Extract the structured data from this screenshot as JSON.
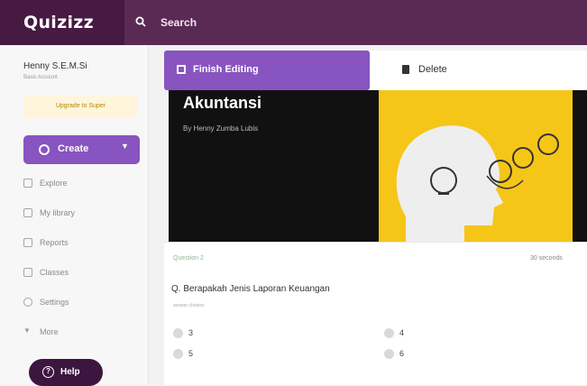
{
  "header": {
    "logo": "Quizizz",
    "search_label": "Search"
  },
  "sidebar": {
    "user_name": "Henny S.E.M.Si",
    "user_subtitle": "Basic Account",
    "upgrade_label": "Upgrade to Super",
    "create_label": "Create",
    "nav": [
      {
        "label": "Explore",
        "icon": "compass-icon"
      },
      {
        "label": "My library",
        "icon": "library-icon"
      },
      {
        "label": "Reports",
        "icon": "reports-icon"
      },
      {
        "label": "Classes",
        "icon": "classes-icon"
      },
      {
        "label": "Settings",
        "icon": "gear-icon"
      },
      {
        "label": "More",
        "icon": "chevron-down-icon"
      }
    ],
    "help_label": "Help"
  },
  "editor": {
    "finish_label": "Finish Editing",
    "delete_label": "Delete"
  },
  "cover": {
    "title": "Akuntansi",
    "byline": "By Henny Zumba Lubis"
  },
  "question": {
    "badge": "Question 2",
    "time": "30 seconds",
    "text": "Q. Berapakah Jenis Laporan Keuangan",
    "type_label": "answer choices",
    "options": [
      "3",
      "4",
      "5",
      "6"
    ]
  },
  "colors": {
    "header_bg": "#461a42",
    "accent": "#8854c0",
    "cover_yellow": "#f5c518"
  }
}
